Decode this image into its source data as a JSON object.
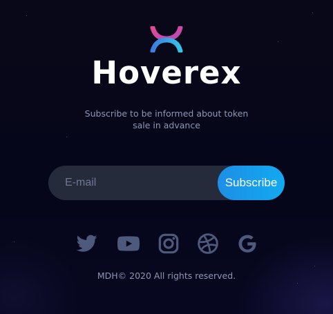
{
  "brand": {
    "name": "Hoverex",
    "logo_icon": "hoverex-logo-icon"
  },
  "tagline": {
    "line1": "Subscribe to be informed about token",
    "line2": "sale in advance"
  },
  "subscribe_form": {
    "email_placeholder": "E-mail",
    "email_value": "",
    "button_label": "Subscribe"
  },
  "social_links": [
    {
      "icon": "twitter-icon"
    },
    {
      "icon": "youtube-icon"
    },
    {
      "icon": "instagram-icon"
    },
    {
      "icon": "dribbble-icon"
    },
    {
      "icon": "google-icon"
    }
  ],
  "footer": {
    "copyright": "MDH© 2020 All rights reserved."
  },
  "colors": {
    "background": "#06061a",
    "input_background": "#252b3b",
    "button_gradient_start": "#1d8fe6",
    "button_gradient_end": "#12a9f0",
    "muted_text": "#8f96b8",
    "icon_color": "#4e5a7c",
    "logo_pink": "#e24a8f",
    "logo_cyan": "#35c3e8"
  }
}
